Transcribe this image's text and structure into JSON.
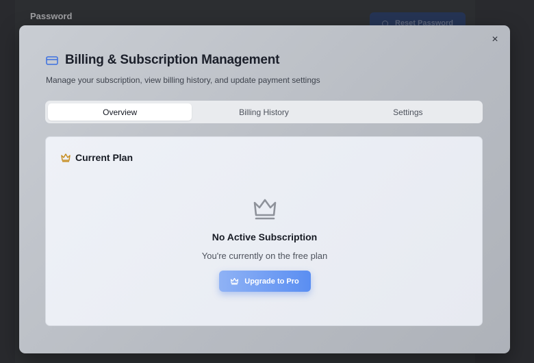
{
  "background": {
    "password_label": "Password",
    "reset_button_label": "Reset Password"
  },
  "modal": {
    "title": "Billing & Subscription Management",
    "subtitle": "Manage your subscription, view billing history, and update payment settings",
    "close_label": "×",
    "tabs": [
      {
        "label": "Overview",
        "active": true
      },
      {
        "label": "Billing History",
        "active": false
      },
      {
        "label": "Settings",
        "active": false
      }
    ],
    "current_plan": {
      "title": "Current Plan",
      "empty_title": "No Active Subscription",
      "empty_subtitle": "You're currently on the free plan",
      "upgrade_label": "Upgrade to Pro"
    }
  },
  "icons": {
    "title": "credit-card-icon",
    "plan": "crown-icon",
    "close": "close-icon"
  },
  "colors": {
    "accent": "#3b6fe0",
    "crown_gold": "#c58a1a",
    "upgrade_start": "#8fb2f5",
    "upgrade_end": "#5a8ef2"
  }
}
